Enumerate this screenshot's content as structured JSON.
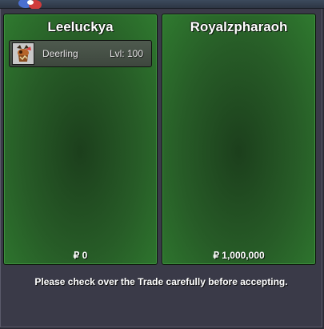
{
  "trade": {
    "left_player": {
      "name": "Leeluckya",
      "pokemon": {
        "name": "Deerling",
        "level": "Lvl: 100",
        "icon": "deerling-icon"
      },
      "money": "₽ 0"
    },
    "right_player": {
      "name": "Royalzpharaoh",
      "money": "₽ 1,000,000"
    },
    "notice": "Please check over the Trade carefully before accepting."
  },
  "colors": {
    "panel_green": "#2f7a2f",
    "panel_dark_green": "#1c3f1c",
    "window_bg": "#3a3a48",
    "text": "#ffffff"
  }
}
